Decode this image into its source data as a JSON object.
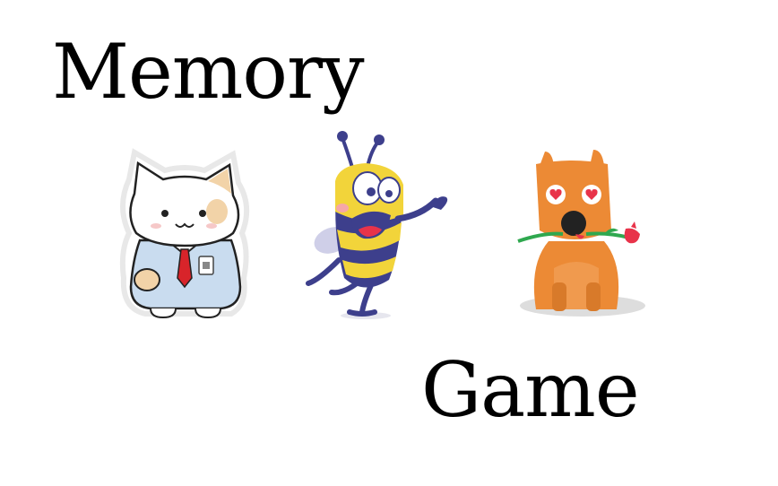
{
  "title": {
    "word1": "Memory",
    "word2": "Game"
  },
  "characters": [
    {
      "name": "cat",
      "icon": "office-cat-sticker"
    },
    {
      "name": "bee",
      "icon": "waving-bee-sticker"
    },
    {
      "name": "dog",
      "icon": "lovestruck-dog-with-rose-sticker"
    }
  ],
  "colors": {
    "text": "#000000",
    "background": "#ffffff",
    "dog_orange": "#ec8a35",
    "bee_yellow": "#f2d43a",
    "bee_navy": "#3d3f8c",
    "cat_shirt": "#c9dcef",
    "tie_red": "#d8242a",
    "heart_red": "#e8334a"
  }
}
